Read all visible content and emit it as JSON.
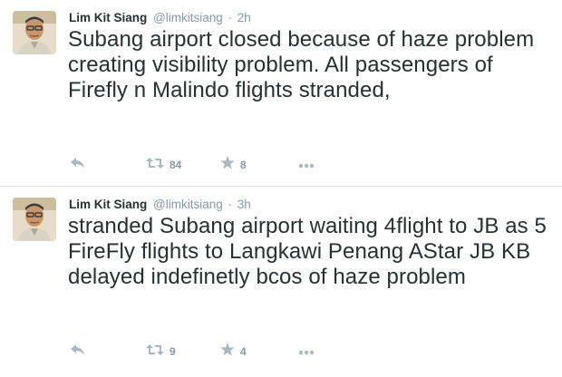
{
  "tweets": [
    {
      "name": "Lim Kit Siang",
      "handle": "@limkitsiang",
      "separator": "·",
      "time": "2h",
      "text": "Subang airport closed because of haze problem creating visibility problem. All passengers of Firefly n Malindo flights stranded,",
      "retweets": "84",
      "favorites": "8"
    },
    {
      "name": "Lim Kit Siang",
      "handle": "@limkitsiang",
      "separator": "·",
      "time": "3h",
      "text": "stranded Subang airport waiting 4flight to JB as 5 FireFly flights to Langkawi Penang AStar JB KB delayed indefinetly bcos of haze problem",
      "retweets": "9",
      "favorites": "4"
    }
  ],
  "icons": {
    "reply": "reply-icon",
    "retweet": "retweet-icon",
    "favorite": "star-icon",
    "more": "more-dots-icon",
    "avatar": "avatar"
  },
  "colors": {
    "text": "#292f33",
    "muted": "#8899a6",
    "divider": "#e1e8ed",
    "icon": "#aab8c2"
  }
}
